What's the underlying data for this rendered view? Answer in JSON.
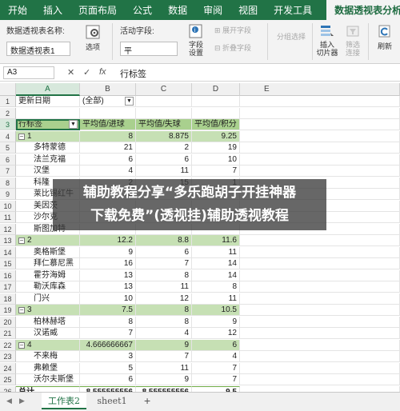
{
  "ribbon_tabs": [
    "开始",
    "插入",
    "页面布局",
    "公式",
    "数据",
    "审阅",
    "视图",
    "开发工具",
    "数据透视表分析"
  ],
  "ribbon": {
    "pivot_name_label": "数据透视表名称:",
    "pivot_name_value": "数据透视表1",
    "options_label": "选项",
    "active_field_label": "活动字段:",
    "active_field_value": "平",
    "field_settings_label": "字段\n设置",
    "expand_field_label": "展开字段",
    "collapse_field_label": "折叠字段",
    "group_selection_label": "分组选择",
    "insert_slicer_label": "插入\n切片器",
    "filter_conn_label": "筛选\n连接",
    "refresh_label": "刷新"
  },
  "formula_bar": {
    "name_box": "A3",
    "cancel_icon": "✕",
    "enter_icon": "✓",
    "fx_label": "fx",
    "content": "行标签"
  },
  "columns": [
    "A",
    "B",
    "C",
    "D",
    "E"
  ],
  "rows": [
    {
      "n": "1",
      "a": "更新日期",
      "b": "(全部)",
      "c": "",
      "d": "",
      "type": "filter"
    },
    {
      "n": "2",
      "a": "",
      "b": "",
      "c": "",
      "d": "",
      "type": "blank"
    },
    {
      "n": "3",
      "a": "行标签",
      "b": "平均值/进球",
      "c": "平均值/失球",
      "d": "平均值/积分",
      "type": "header"
    },
    {
      "n": "4",
      "a": "1",
      "b": "8",
      "c": "8.875",
      "d": "9.25",
      "type": "group"
    },
    {
      "n": "5",
      "a": "多特蒙德",
      "b": "21",
      "c": "2",
      "d": "19",
      "type": "item"
    },
    {
      "n": "6",
      "a": "法兰克福",
      "b": "6",
      "c": "6",
      "d": "10",
      "type": "item"
    },
    {
      "n": "7",
      "a": "汉堡",
      "b": "4",
      "c": "11",
      "d": "7",
      "type": "item"
    },
    {
      "n": "8",
      "a": "科隆",
      "b": "2",
      "c": "15",
      "d": "1",
      "type": "item"
    },
    {
      "n": "9",
      "a": "莱比锡红牛",
      "b": "12",
      "c": "",
      "d": "",
      "type": "item"
    },
    {
      "n": "10",
      "a": "美因茨",
      "b": "",
      "c": "",
      "d": "",
      "type": "item"
    },
    {
      "n": "11",
      "a": "沙尔克",
      "b": "",
      "c": "",
      "d": "",
      "type": "item"
    },
    {
      "n": "12",
      "a": "斯图加特",
      "b": "",
      "c": "",
      "d": "",
      "type": "item"
    },
    {
      "n": "13",
      "a": "2",
      "b": "12.2",
      "c": "8.8",
      "d": "11.6",
      "type": "group"
    },
    {
      "n": "14",
      "a": "奥格斯堡",
      "b": "9",
      "c": "6",
      "d": "11",
      "type": "item"
    },
    {
      "n": "15",
      "a": "拜仁慕尼黑",
      "b": "16",
      "c": "7",
      "d": "14",
      "type": "item"
    },
    {
      "n": "16",
      "a": "霍芬海姆",
      "b": "13",
      "c": "8",
      "d": "14",
      "type": "item"
    },
    {
      "n": "17",
      "a": "勒沃库森",
      "b": "13",
      "c": "11",
      "d": "8",
      "type": "item"
    },
    {
      "n": "18",
      "a": "门兴",
      "b": "10",
      "c": "12",
      "d": "11",
      "type": "item"
    },
    {
      "n": "19",
      "a": "3",
      "b": "7.5",
      "c": "8",
      "d": "10.5",
      "type": "group"
    },
    {
      "n": "20",
      "a": "柏林赫塔",
      "b": "8",
      "c": "8",
      "d": "9",
      "type": "item"
    },
    {
      "n": "21",
      "a": "汉诺威",
      "b": "7",
      "c": "4",
      "d": "12",
      "type": "item"
    },
    {
      "n": "22",
      "a": "4",
      "b": "4.666666667",
      "c": "9",
      "d": "6",
      "type": "group"
    },
    {
      "n": "23",
      "a": "不来梅",
      "b": "3",
      "c": "7",
      "d": "4",
      "type": "item"
    },
    {
      "n": "24",
      "a": "弗赖堡",
      "b": "5",
      "c": "11",
      "d": "7",
      "type": "item"
    },
    {
      "n": "25",
      "a": "沃尔夫斯堡",
      "b": "6",
      "c": "9",
      "d": "7",
      "type": "item"
    },
    {
      "n": "26",
      "a": "总计",
      "b": "8.555555556",
      "c": "8.555555556",
      "d": "9.5",
      "type": "total"
    },
    {
      "n": "27",
      "a": "",
      "b": "",
      "c": "",
      "d": "",
      "type": "blank"
    }
  ],
  "banner": {
    "line1": "辅助教程分享“多乐跑胡子开挂神器",
    "line2": "下载免费”(透视挂)辅助透视教程"
  },
  "sheet_tabs": [
    "工作表2",
    "sheet1"
  ],
  "active_sheet": "工作表2",
  "add_sheet": "+",
  "colors": {
    "accent": "#217346",
    "band": "#c6e0b4",
    "header": "#a9d08e"
  }
}
